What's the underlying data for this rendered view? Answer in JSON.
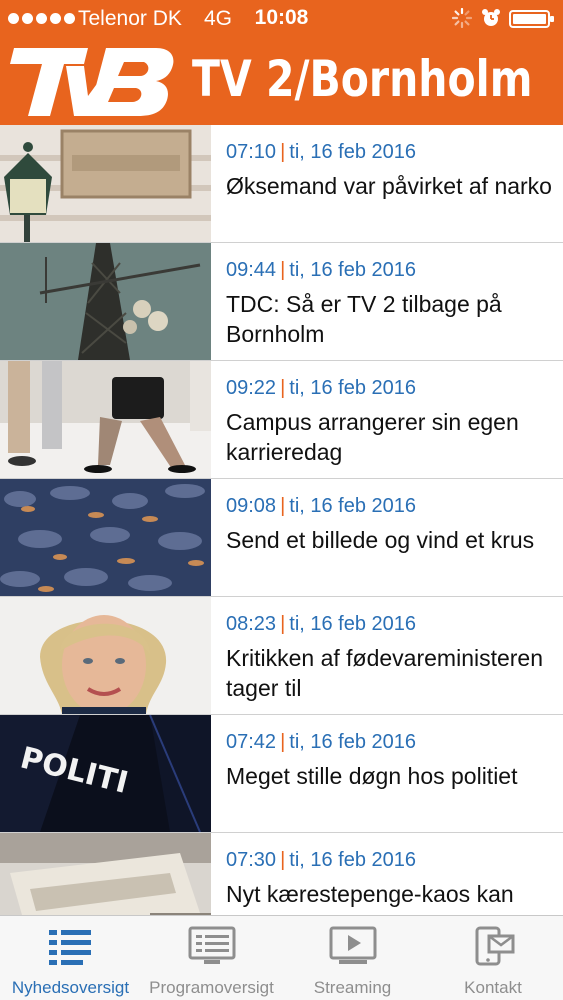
{
  "status_bar": {
    "carrier": "Telenor DK",
    "network": "4G",
    "time": "10:08"
  },
  "header": {
    "channel_name": "TV 2/Bornholm",
    "background_color": "#e8641e"
  },
  "news": [
    {
      "time": "07:10",
      "date": "ti, 16 feb 2016",
      "title": "Øksemand var påvirket af narko"
    },
    {
      "time": "09:44",
      "date": "ti, 16 feb 2016",
      "title": "TDC: Så er TV 2 tilbage på Bornholm"
    },
    {
      "time": "09:22",
      "date": "ti, 16 feb 2016",
      "title": "Campus arrangerer sin egen karrieredag"
    },
    {
      "time": "09:08",
      "date": "ti, 16 feb 2016",
      "title": "Send et billede og vind et krus"
    },
    {
      "time": "08:23",
      "date": "ti, 16 feb 2016",
      "title": "Kritikken af fødevareministeren tager til"
    },
    {
      "time": "07:42",
      "date": "ti, 16 feb 2016",
      "title": "Meget stille døgn hos politiet"
    },
    {
      "time": "07:30",
      "date": "ti, 16 feb 2016",
      "title": "Nyt kærestepenge-kaos kan"
    }
  ],
  "thumb_text": {
    "police": "POLITI"
  },
  "tabs": [
    {
      "label": "Nyhedsoversigt",
      "icon": "list-icon",
      "active": true
    },
    {
      "label": "Programoversigt",
      "icon": "schedule-icon",
      "active": false
    },
    {
      "label": "Streaming",
      "icon": "play-icon",
      "active": false
    },
    {
      "label": "Kontakt",
      "icon": "contact-icon",
      "active": false
    }
  ],
  "colors": {
    "accent": "#e8641e",
    "link_blue": "#2a6fb5"
  }
}
